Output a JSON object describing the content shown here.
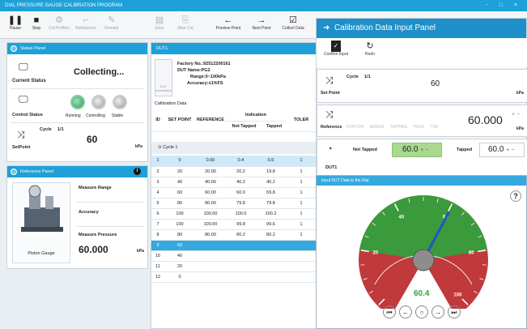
{
  "window": {
    "title": "DIAL PRESSURE GAUGE CALIBRATION PROGRAM",
    "controls": "- □ ×"
  },
  "toolbar": {
    "pause": "Pause",
    "stop": "Stop",
    "cal_profiles": "Cal Profiles",
    "references": "References",
    "remark": "Remark",
    "save": "Save",
    "abort_cal": "Abor Cal",
    "preview_point": "Preview Point",
    "next_point": "Next Point",
    "collect_data": "Collect Data"
  },
  "status_panel": {
    "title": "Status Panel",
    "current_status_label": "Current Status",
    "current_status_value": "Collecting...",
    "control_status_label": "Control Status",
    "running": "Running",
    "controlling": "Controlling",
    "stable": "Stable",
    "cycle_label": "Cycle",
    "cycle_value": "1/1",
    "setpoint_label": "SetPoint",
    "setpoint_value": "60",
    "unit": "kPa"
  },
  "reference_panel": {
    "title": "Reference Panel",
    "measure_range": "Measure Range",
    "accuracy": "Accuracy",
    "measure_pressure": "Measure Pressure",
    "device": "Piston Gauge",
    "pressure_value": "60.000",
    "unit": "kPa"
  },
  "dut_panel": {
    "title": "DUT1",
    "factory_no": "Factory No.:92512200161",
    "dut_name": "DUT Name:PG2",
    "range": "Range:0~100kPa",
    "accuracy": "Accuracy:±1%FS",
    "thumb_label": "DUT Information",
    "cal_data_label": "Calibration Data",
    "headers": {
      "id": "ID",
      "set_point": "SET POINT",
      "reference": "REFERENCE",
      "indication": "Indication",
      "not_tapped": "Not Tapped",
      "tapped": "Tapped",
      "tolerance": "TOLER"
    },
    "group": "Cycle 1",
    "rows": [
      {
        "id": "1",
        "sp": "0",
        "ref": "0.00",
        "nt": "0.4",
        "t": "0.6"
      },
      {
        "id": "2",
        "sp": "20",
        "ref": "20.00",
        "nt": "20.2",
        "t": "19.8"
      },
      {
        "id": "3",
        "sp": "40",
        "ref": "40.00",
        "nt": "40.2",
        "t": "40.2"
      },
      {
        "id": "4",
        "sp": "60",
        "ref": "60.00",
        "nt": "60.0",
        "t": "59.8"
      },
      {
        "id": "5",
        "sp": "80",
        "ref": "80.00",
        "nt": "79.8",
        "t": "79.8"
      },
      {
        "id": "6",
        "sp": "100",
        "ref": "100.00",
        "nt": "100.0",
        "t": "100.2"
      },
      {
        "id": "7",
        "sp": "100",
        "ref": "100.00",
        "nt": "99.8",
        "t": "99.6"
      },
      {
        "id": "8",
        "sp": "80",
        "ref": "80.00",
        "nt": "80.2",
        "t": "80.2"
      },
      {
        "id": "9",
        "sp": "60",
        "ref": "",
        "nt": "",
        "t": ""
      },
      {
        "id": "10",
        "sp": "40",
        "ref": "",
        "nt": "",
        "t": ""
      },
      {
        "id": "11",
        "sp": "20",
        "ref": "",
        "nt": "",
        "t": ""
      },
      {
        "id": "12",
        "sp": "0",
        "ref": "",
        "nt": "",
        "t": ""
      }
    ],
    "col_one": "1"
  },
  "input_panel": {
    "title": "Calibration Data Input Panel",
    "confirm_input": "Confirm Input",
    "redo": "Redo",
    "cycle_label": "Cycle",
    "cycle_value": "1/1",
    "set_point_label": "Set Point",
    "set_point_value": "60",
    "unit": "kPa",
    "reference_label": "Reference",
    "reference_value": "60.000",
    "dut_label": "DUT1",
    "not_tapped_label": "Not Tapped",
    "not_tapped_value": "60.0",
    "tapped_label": "Tapped",
    "tapped_value": "60.0",
    "pm": "+ −",
    "ghost_headers": [
      "NTATION ERROR",
      "TAPPING",
      "PASS",
      "TSB"
    ]
  },
  "gauge_popup": {
    "title": "Input DUT Data to the Dial",
    "help": "?",
    "reading": "60.4",
    "ticks": [
      "20",
      "40",
      "60",
      "80",
      "100"
    ],
    "scale_min": 0,
    "scale_max": 100,
    "needle_value": 60.4,
    "nav": [
      "⏮",
      "←",
      "○",
      "→",
      "⏭"
    ]
  },
  "colors": {
    "accent": "#1da1d8",
    "green": "#3b9a3b",
    "red": "#c0393b"
  }
}
